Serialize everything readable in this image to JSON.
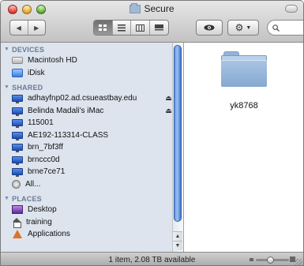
{
  "window": {
    "title": "Secure"
  },
  "toolbar": {
    "back_icon": "◀",
    "forward_icon": "▶",
    "view_buttons": [
      "icon-view-icon",
      "list-view-icon",
      "column-view-icon",
      "coverflow-view-icon"
    ],
    "quicklook_icon": "eye-icon",
    "action_icon": "gear-icon",
    "search_placeholder": ""
  },
  "sidebar": {
    "devices_label": "DEVICES",
    "devices": [
      {
        "label": "Macintosh HD",
        "icon": "hard-drive-icon"
      },
      {
        "label": "iDisk",
        "icon": "idisk-icon"
      }
    ],
    "shared_label": "SHARED",
    "shared": [
      {
        "label": "adhayfnp02.ad.csueastbay.edu",
        "icon": "server-icon",
        "eject": true
      },
      {
        "label": "Belinda Madali's iMac",
        "icon": "computer-icon",
        "eject": true
      },
      {
        "label": "115001",
        "icon": "computer-icon"
      },
      {
        "label": "AE192-113314-CLASS",
        "icon": "computer-icon"
      },
      {
        "label": "brn_7bf3ff",
        "icon": "computer-icon"
      },
      {
        "label": "brnccc0d",
        "icon": "computer-icon"
      },
      {
        "label": "brne7ce71",
        "icon": "computer-icon"
      },
      {
        "label": "All...",
        "icon": "network-icon"
      }
    ],
    "places_label": "PLACES",
    "places": [
      {
        "label": "Desktop",
        "icon": "desktop-icon"
      },
      {
        "label": "training",
        "icon": "home-icon"
      },
      {
        "label": "Applications",
        "icon": "applications-icon"
      }
    ],
    "eject_glyph": "⏏"
  },
  "content": {
    "items": [
      {
        "name": "yk8768",
        "icon": "folder-icon"
      }
    ]
  },
  "status_bar": {
    "text": "1 item, 2.08 TB available"
  }
}
